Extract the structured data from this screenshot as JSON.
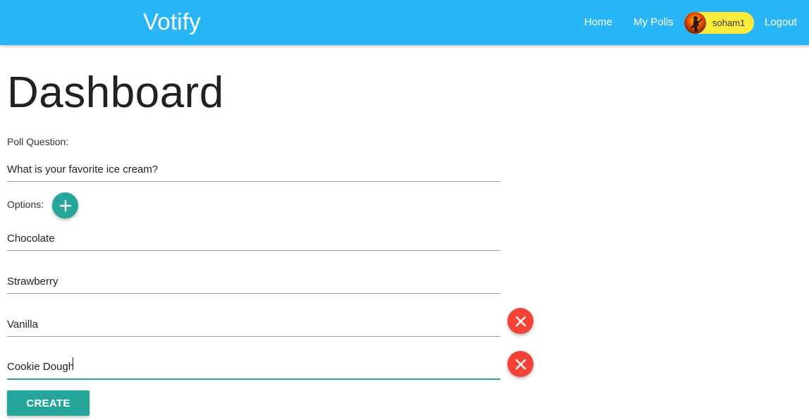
{
  "navbar": {
    "brand": "Votify",
    "links": {
      "home": "Home",
      "my_polls": "My Polls",
      "logout": "Logout"
    },
    "user": {
      "username": "soham1",
      "avatar_icon": "user-avatar"
    },
    "colors": {
      "background": "#29b6f6",
      "chip": "#ffeb3b"
    }
  },
  "page": {
    "title": "Dashboard"
  },
  "form": {
    "question_label": "Poll Question:",
    "question_value": "What is your favorite ice cream?",
    "options_label": "Options:",
    "add_option_icon": "plus-icon",
    "remove_option_icon": "close-icon",
    "options": [
      {
        "value": "Chocolate",
        "removable": false
      },
      {
        "value": "Strawberry",
        "removable": false
      },
      {
        "value": "Vanilla",
        "removable": true
      },
      {
        "value": "Cookie Dough",
        "removable": true,
        "focused": true
      }
    ],
    "submit_label": "Create",
    "colors": {
      "accent": "#26a69a",
      "remove": "#f44336"
    }
  }
}
